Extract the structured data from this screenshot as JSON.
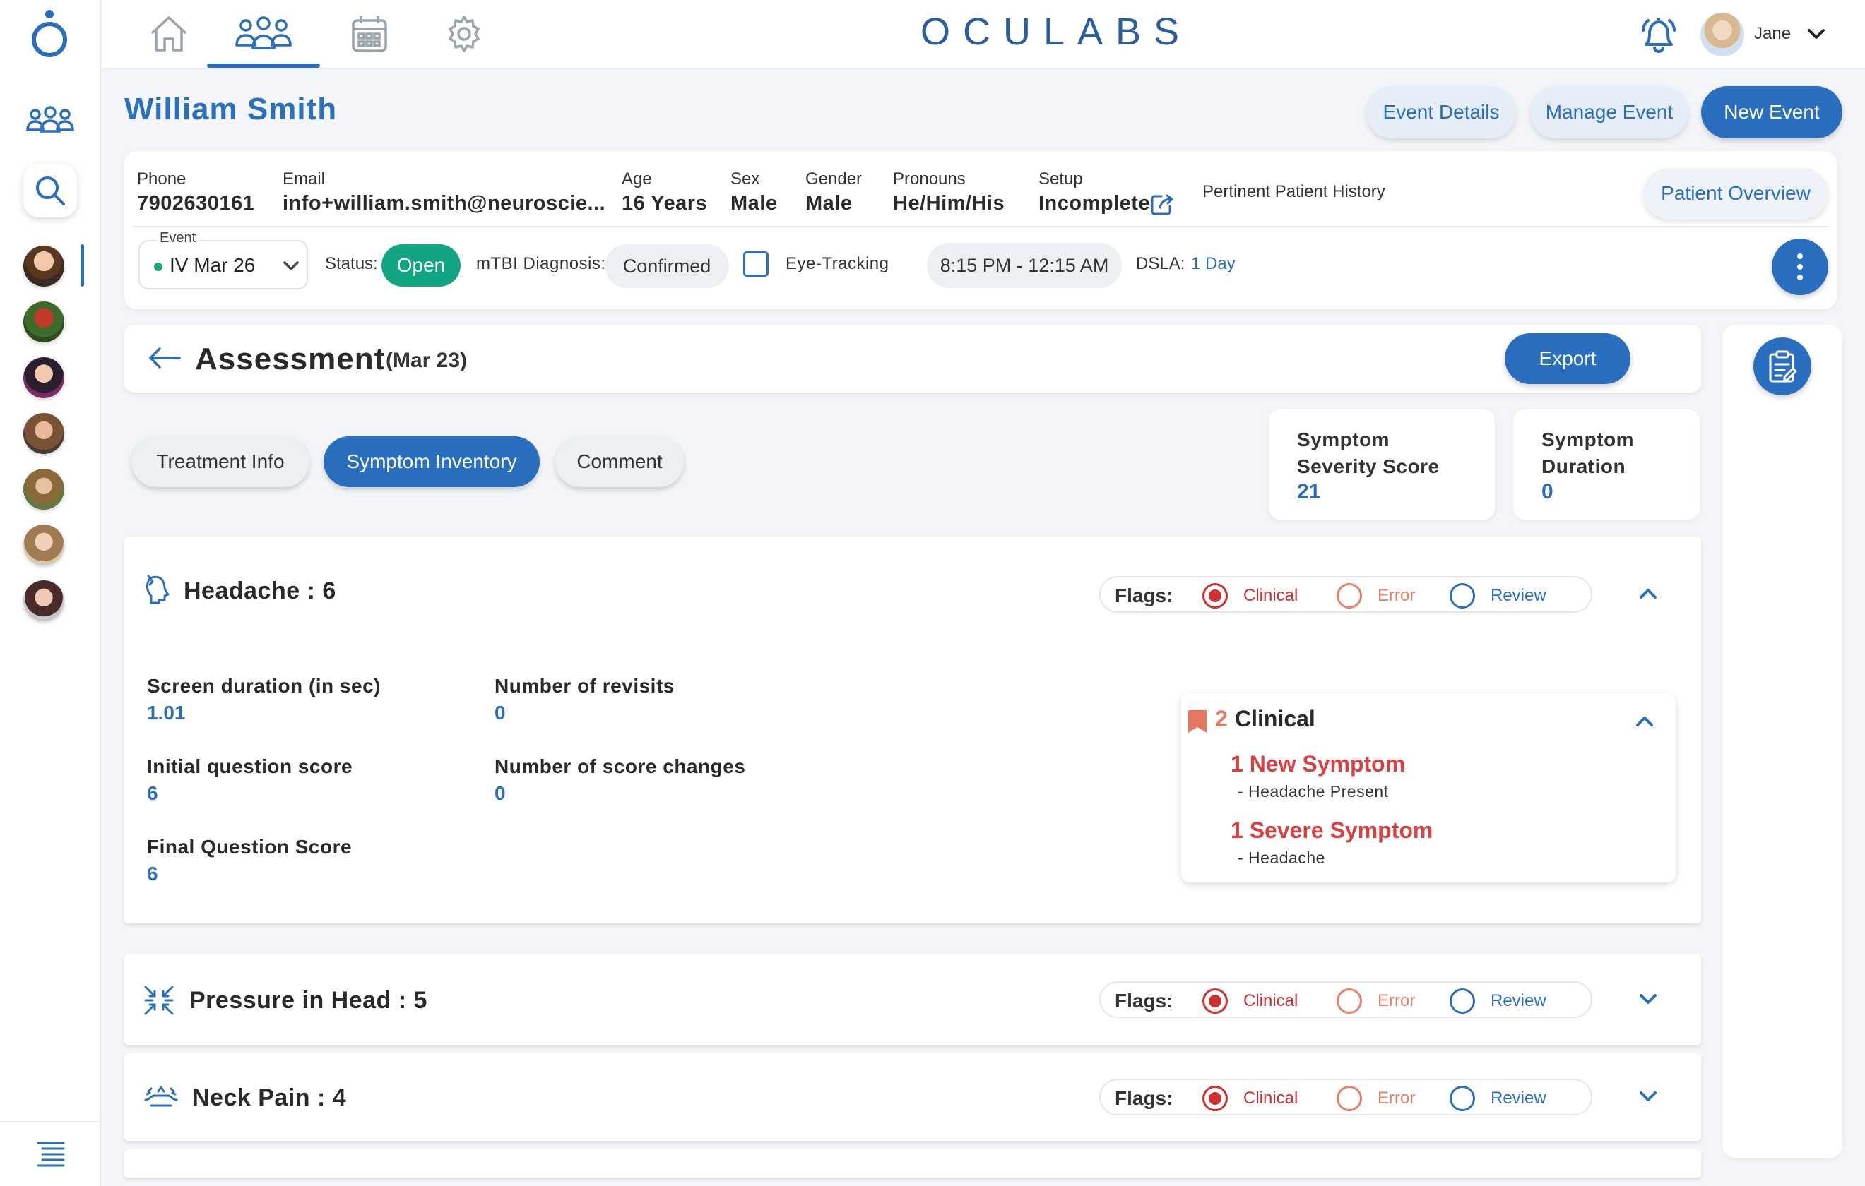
{
  "brand": "OCULABS",
  "user": {
    "name": "Jane"
  },
  "nav": [
    "home-icon",
    "patients-icon",
    "calendar-icon",
    "settings-icon"
  ],
  "patient": {
    "name": "William Smith",
    "fields": [
      {
        "label": "Phone",
        "value": "7902630161"
      },
      {
        "label": "Email",
        "value": "info+william.smith@neuroscie..."
      },
      {
        "label": "Age",
        "value": "16 Years"
      },
      {
        "label": "Sex",
        "value": "Male"
      },
      {
        "label": "Gender",
        "value": "Male"
      },
      {
        "label": "Pronouns",
        "value": "He/Him/His"
      },
      {
        "label": "Setup",
        "value": "Incomplete"
      }
    ],
    "history_label": "Pertinent Patient History",
    "overview_button": "Patient Overview"
  },
  "header_buttons": {
    "event_details": "Event Details",
    "manage_event": "Manage Event",
    "new_event": "New Event"
  },
  "event": {
    "label": "Event",
    "value": "IV Mar 26",
    "status_label": "Status:",
    "status_value": "Open",
    "mtbi_label": "mTBI Diagnosis:",
    "mtbi_value": "Confirmed",
    "eye_tracking_label": "Eye-Tracking",
    "eye_tracking_checked": false,
    "time_range": "8:15 PM - 12:15 AM",
    "dsla_label": "DSLA:",
    "dsla_value": "1 Day"
  },
  "assessment": {
    "title": "Assessment",
    "date": "(Mar 23)",
    "export_label": "Export"
  },
  "tabs": [
    {
      "label": "Treatment Info",
      "active": false
    },
    {
      "label": "Symptom Inventory",
      "active": true
    },
    {
      "label": "Comment",
      "active": false
    }
  ],
  "scores": [
    {
      "label_line1": "Symptom",
      "label_line2": "Severity Score",
      "value": "21"
    },
    {
      "label_line1": "Symptom",
      "label_line2": "Duration",
      "value": "0"
    }
  ],
  "flags": {
    "label": "Flags:",
    "options": [
      "Clinical",
      "Error",
      "Review"
    ],
    "colors": {
      "clinical": "#cf3030",
      "error": "#e8806a",
      "review": "#2a6fbf"
    }
  },
  "symptoms": [
    {
      "title": "Headache : 6",
      "icon": "headache-icon",
      "expanded": true,
      "flag_selected": "Clinical",
      "metrics": [
        {
          "label": "Screen duration (in sec)",
          "value": "1.01"
        },
        {
          "label": "Number of revisits",
          "value": "0"
        },
        {
          "label": "Initial question score",
          "value": "6"
        },
        {
          "label": "Number of score changes",
          "value": "0"
        },
        {
          "label": "Final Question Score",
          "value": "6"
        }
      ],
      "clinical": {
        "count": "2",
        "title": "Clinical",
        "items": [
          {
            "title": "1 New Symptom",
            "sub": "- Headache Present"
          },
          {
            "title": "1 Severe Symptom",
            "sub": "- Headache"
          }
        ]
      }
    },
    {
      "title": "Pressure in Head : 5",
      "icon": "pressure-icon",
      "expanded": false,
      "flag_selected": "Clinical"
    },
    {
      "title": "Neck Pain : 4",
      "icon": "neck-pain-icon",
      "expanded": false,
      "flag_selected": "Clinical"
    }
  ],
  "colors": {
    "accent": "#2a6fbf",
    "status_open": "#12a583",
    "clinical_red": "#d94040"
  }
}
